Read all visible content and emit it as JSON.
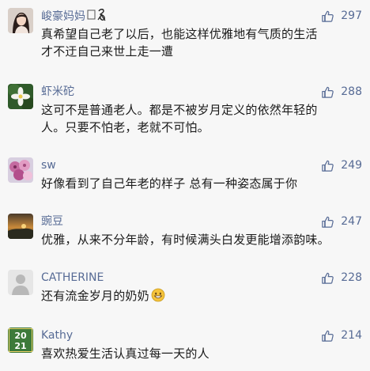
{
  "comments": [
    {
      "name": "峻豪妈妈",
      "name_suffix": "🎀",
      "likes": "297",
      "text_lines": [
        "真希望自己老了以后，也能这样优雅地有气质的生活",
        "才不迂自己来世上走一遭"
      ],
      "avatar": "woman-portrait"
    },
    {
      "name": "虾米砣",
      "likes": "288",
      "text_lines": [
        "这可不是普通老人。都是不被岁月定义的依然年轻的",
        "人。只要不怕老，老就不可怕。"
      ],
      "avatar": "white-flower"
    },
    {
      "name": "sw",
      "likes": "249",
      "text_lines": [
        "好像看到了自己年老的样子 总有一种姿态属于你"
      ],
      "avatar": "pink-flowers"
    },
    {
      "name": "豌豆",
      "likes": "247",
      "text_lines": [
        "优雅，从来不分年龄，有时候满头白发更能增添韵味。"
      ],
      "avatar": "sunset-landscape"
    },
    {
      "name": "CATHERINE",
      "likes": "228",
      "text_lines": [
        "还有流金岁月的奶奶"
      ],
      "emoji": "grinning-face-emoji",
      "avatar": "default-person"
    },
    {
      "name": "Kathy",
      "likes": "214",
      "text_lines": [
        "喜欢热爱生活认真过每一天的人"
      ],
      "avatar": "2021-badge",
      "avatar_text_top": "20",
      "avatar_text_bottom": "21"
    }
  ],
  "colors": {
    "name": "#576b95",
    "like": "#576b95",
    "text": "#1a1a1a",
    "background": "#f7f7f7"
  }
}
